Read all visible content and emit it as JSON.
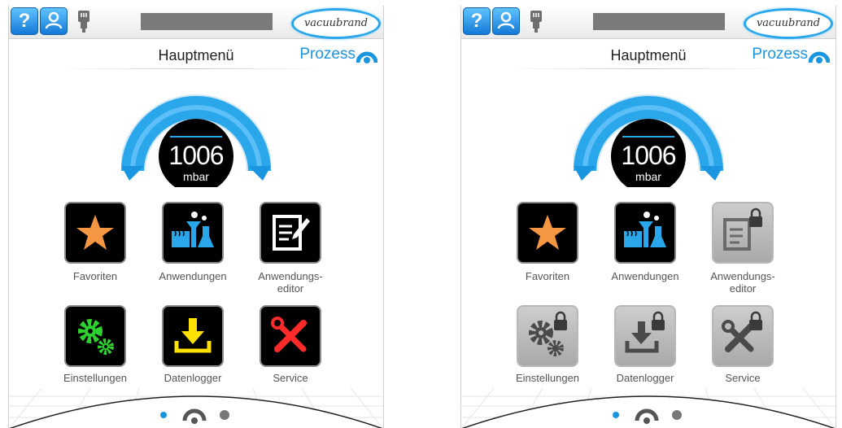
{
  "header": {
    "help_icon_text": "?",
    "logo_text": "vacuubrand"
  },
  "nav": {
    "title": "Hauptmenü",
    "process_label": "Prozess"
  },
  "gauge": {
    "value": "1006",
    "unit": "mbar"
  },
  "menu": {
    "favorites": "Favoriten",
    "applications": "Anwendungen",
    "app_editor_line1": "Anwendungs-",
    "app_editor_line2": "editor",
    "settings": "Einstellungen",
    "datalogger": "Datenlogger",
    "service": "Service"
  },
  "panels": [
    {
      "state": "unlocked"
    },
    {
      "state": "locked"
    }
  ],
  "pager": {
    "page_count": 3,
    "active_page": 2
  },
  "colors": {
    "accent": "#1a95e0",
    "gauge": "#2aa6ea",
    "favorites_star": "#f59642",
    "settings_gears": "#2fd12f",
    "datalogger_arrow": "#ffe100",
    "service_tools": "#ff2a2a",
    "locked_tile": "#b8b8b8"
  }
}
